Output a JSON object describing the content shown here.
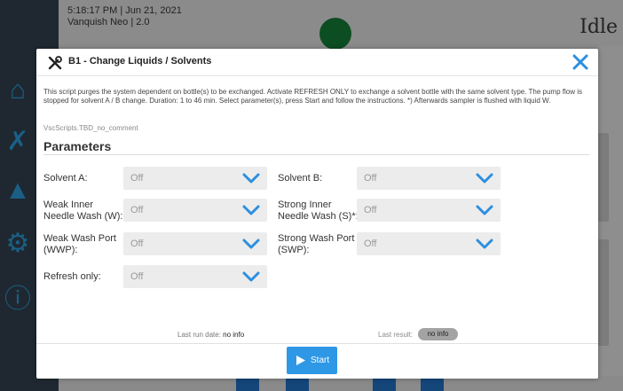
{
  "background": {
    "time": "5:18:17 PM | Jun 21, 2021",
    "instrument": "Vanquish Neo | 2.0",
    "status": "Idle",
    "accent": "#1a5f86"
  },
  "dialog": {
    "title": "B1 - Change Liquids / Solvents",
    "description": "This script purges the system dependent on bottle(s) to be exchanged. Activate REFRESH ONLY to exchange a solvent bottle with the same solvent type. The pump flow is stopped for solvent A / B change. Duration: 1 to 46 min. Select parameter(s), press Start and follow the instructions. *) Afterwards sampler is flushed with liquid W.",
    "script_name": "VscScripts.TBD_no_comment",
    "parameters_heading": "Parameters",
    "params": {
      "solvent_a": {
        "label": "Solvent A:",
        "value": "Off"
      },
      "solvent_b": {
        "label": "Solvent B:",
        "value": "Off"
      },
      "weak_inner": {
        "label1": "Weak Inner",
        "label2": "Needle Wash (W):",
        "value": "Off"
      },
      "strong_inner": {
        "label1": "Strong Inner",
        "label2": "Needle Wash (S)*:",
        "value": "Off"
      },
      "weak_port": {
        "label1": "Weak Wash Port",
        "label2": "(WWP):",
        "value": "Off"
      },
      "strong_port": {
        "label1": "Strong Wash Port",
        "label2": "(SWP):",
        "value": "Off"
      },
      "refresh": {
        "label": "Refresh only:",
        "value": "Off"
      }
    },
    "last_run_label": "Last run date: ",
    "last_run_value": "no info",
    "last_result_label": "Last result:",
    "last_result_value": "no info",
    "start_label": "Start",
    "colors": {
      "primary": "#2f98e6",
      "close": "#2b8fe0"
    }
  }
}
